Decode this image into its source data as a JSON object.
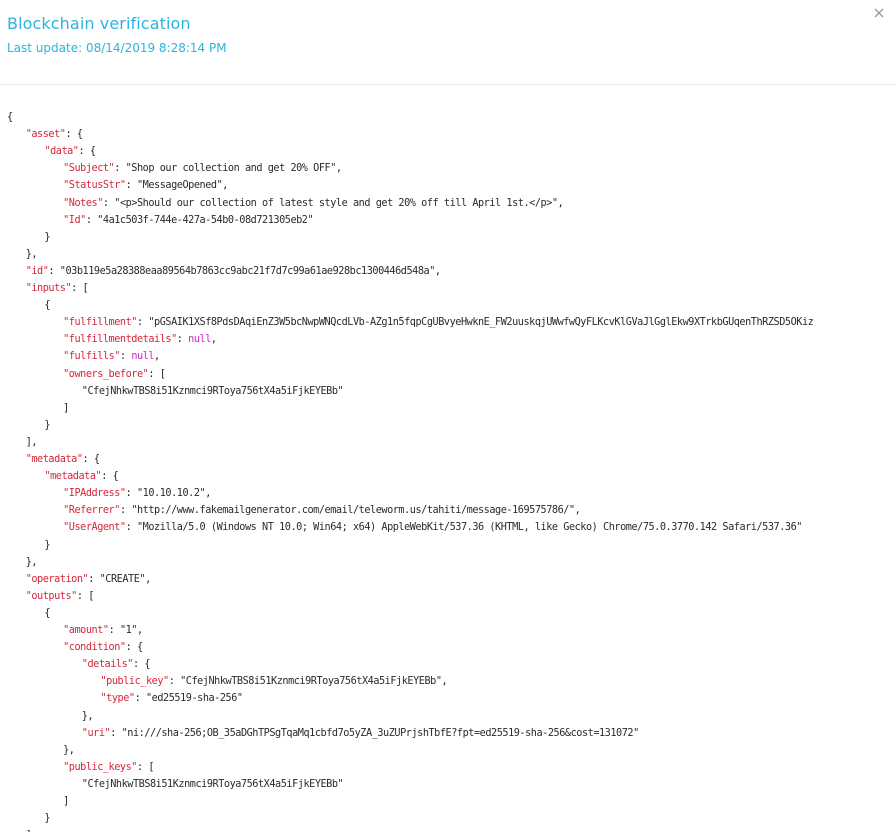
{
  "header": {
    "title": "Blockchain verification",
    "last_update": "Last update: 08/14/2019 8:28:14 PM",
    "close_icon": "close-icon"
  },
  "colors": {
    "title": "#2ab4e0",
    "json_key": "#d6263a",
    "json_null": "#d21fd2",
    "json_string": "#2a2a2a"
  },
  "json_lines": [
    {
      "indent": 0,
      "parts": [
        {
          "t": "p",
          "v": "{"
        }
      ]
    },
    {
      "indent": 1,
      "parts": [
        {
          "t": "k",
          "v": "\"asset\""
        },
        {
          "t": "p",
          "v": ": {"
        }
      ]
    },
    {
      "indent": 2,
      "parts": [
        {
          "t": "k",
          "v": "\"data\""
        },
        {
          "t": "p",
          "v": ": {"
        }
      ]
    },
    {
      "indent": 3,
      "parts": [
        {
          "t": "k",
          "v": "\"Subject\""
        },
        {
          "t": "p",
          "v": ": "
        },
        {
          "t": "s",
          "v": "\"Shop our collection and get 20% OFF\""
        },
        {
          "t": "p",
          "v": ","
        }
      ]
    },
    {
      "indent": 3,
      "parts": [
        {
          "t": "k",
          "v": "\"StatusStr\""
        },
        {
          "t": "p",
          "v": ": "
        },
        {
          "t": "s",
          "v": "\"MessageOpened\""
        },
        {
          "t": "p",
          "v": ","
        }
      ]
    },
    {
      "indent": 3,
      "parts": [
        {
          "t": "k",
          "v": "\"Notes\""
        },
        {
          "t": "p",
          "v": ": "
        },
        {
          "t": "s",
          "v": "\"<p>Should our collection of latest style and get 20% off till April 1st.</p>\""
        },
        {
          "t": "p",
          "v": ","
        }
      ]
    },
    {
      "indent": 3,
      "parts": [
        {
          "t": "k",
          "v": "\"Id\""
        },
        {
          "t": "p",
          "v": ": "
        },
        {
          "t": "s",
          "v": "\"4a1c503f-744e-427a-54b0-08d721305eb2\""
        }
      ]
    },
    {
      "indent": 2,
      "parts": [
        {
          "t": "p",
          "v": "}"
        }
      ]
    },
    {
      "indent": 1,
      "parts": [
        {
          "t": "p",
          "v": "},"
        }
      ]
    },
    {
      "indent": 1,
      "parts": [
        {
          "t": "k",
          "v": "\"id\""
        },
        {
          "t": "p",
          "v": ": "
        },
        {
          "t": "s",
          "v": "\"03b119e5a28388eaa89564b7863cc9abc21f7d7c99a61ae928bc1300446d548a\""
        },
        {
          "t": "p",
          "v": ","
        }
      ]
    },
    {
      "indent": 1,
      "parts": [
        {
          "t": "k",
          "v": "\"inputs\""
        },
        {
          "t": "p",
          "v": ": ["
        }
      ]
    },
    {
      "indent": 2,
      "parts": [
        {
          "t": "p",
          "v": "{"
        }
      ]
    },
    {
      "indent": 3,
      "parts": [
        {
          "t": "k",
          "v": "\"fulfillment\""
        },
        {
          "t": "p",
          "v": ": "
        },
        {
          "t": "s",
          "v": "\"pGSAIK1XSf8PdsDAqiEnZ3W5bcNwpWNQcdLVb-AZg1n5fqpCgUBvyeHwknE_FW2uuskqjUWwfwQyFLKcvKlGVaJlGglEkw9XTrkbGUqenThRZSD5OKiz"
        }
      ]
    },
    {
      "indent": 3,
      "parts": [
        {
          "t": "k",
          "v": "\"fulfillmentdetails\""
        },
        {
          "t": "p",
          "v": ": "
        },
        {
          "t": "n",
          "v": "null"
        },
        {
          "t": "p",
          "v": ","
        }
      ]
    },
    {
      "indent": 3,
      "parts": [
        {
          "t": "k",
          "v": "\"fulfills\""
        },
        {
          "t": "p",
          "v": ": "
        },
        {
          "t": "n",
          "v": "null"
        },
        {
          "t": "p",
          "v": ","
        }
      ]
    },
    {
      "indent": 3,
      "parts": [
        {
          "t": "k",
          "v": "\"owners_before\""
        },
        {
          "t": "p",
          "v": ": ["
        }
      ]
    },
    {
      "indent": 4,
      "parts": [
        {
          "t": "s",
          "v": "\"CfejNhkwTBS8i51Kznmci9RToya756tX4a5iFjkEYEBb\""
        }
      ]
    },
    {
      "indent": 3,
      "parts": [
        {
          "t": "p",
          "v": "]"
        }
      ]
    },
    {
      "indent": 2,
      "parts": [
        {
          "t": "p",
          "v": "}"
        }
      ]
    },
    {
      "indent": 1,
      "parts": [
        {
          "t": "p",
          "v": "],"
        }
      ]
    },
    {
      "indent": 1,
      "parts": [
        {
          "t": "k",
          "v": "\"metadata\""
        },
        {
          "t": "p",
          "v": ": {"
        }
      ]
    },
    {
      "indent": 2,
      "parts": [
        {
          "t": "k",
          "v": "\"metadata\""
        },
        {
          "t": "p",
          "v": ": {"
        }
      ]
    },
    {
      "indent": 3,
      "parts": [
        {
          "t": "k",
          "v": "\"IPAddress\""
        },
        {
          "t": "p",
          "v": ": "
        },
        {
          "t": "s",
          "v": "\"10.10.10.2\""
        },
        {
          "t": "p",
          "v": ","
        }
      ]
    },
    {
      "indent": 3,
      "parts": [
        {
          "t": "k",
          "v": "\"Referrer\""
        },
        {
          "t": "p",
          "v": ": "
        },
        {
          "t": "s",
          "v": "\"http://www.fakemailgenerator.com/email/teleworm.us/tahiti/message-169575786/\""
        },
        {
          "t": "p",
          "v": ","
        }
      ]
    },
    {
      "indent": 3,
      "parts": [
        {
          "t": "k",
          "v": "\"UserAgent\""
        },
        {
          "t": "p",
          "v": ": "
        },
        {
          "t": "s",
          "v": "\"Mozilla/5.0 (Windows NT 10.0; Win64; x64) AppleWebKit/537.36 (KHTML, like Gecko) Chrome/75.0.3770.142 Safari/537.36\""
        }
      ]
    },
    {
      "indent": 2,
      "parts": [
        {
          "t": "p",
          "v": "}"
        }
      ]
    },
    {
      "indent": 1,
      "parts": [
        {
          "t": "p",
          "v": "},"
        }
      ]
    },
    {
      "indent": 1,
      "parts": [
        {
          "t": "k",
          "v": "\"operation\""
        },
        {
          "t": "p",
          "v": ": "
        },
        {
          "t": "s",
          "v": "\"CREATE\""
        },
        {
          "t": "p",
          "v": ","
        }
      ]
    },
    {
      "indent": 1,
      "parts": [
        {
          "t": "k",
          "v": "\"outputs\""
        },
        {
          "t": "p",
          "v": ": ["
        }
      ]
    },
    {
      "indent": 2,
      "parts": [
        {
          "t": "p",
          "v": "{"
        }
      ]
    },
    {
      "indent": 3,
      "parts": [
        {
          "t": "k",
          "v": "\"amount\""
        },
        {
          "t": "p",
          "v": ": "
        },
        {
          "t": "s",
          "v": "\"1\""
        },
        {
          "t": "p",
          "v": ","
        }
      ]
    },
    {
      "indent": 3,
      "parts": [
        {
          "t": "k",
          "v": "\"condition\""
        },
        {
          "t": "p",
          "v": ": {"
        }
      ]
    },
    {
      "indent": 4,
      "parts": [
        {
          "t": "k",
          "v": "\"details\""
        },
        {
          "t": "p",
          "v": ": {"
        }
      ]
    },
    {
      "indent": 5,
      "parts": [
        {
          "t": "k",
          "v": "\"public_key\""
        },
        {
          "t": "p",
          "v": ": "
        },
        {
          "t": "s",
          "v": "\"CfejNhkwTBS8i51Kznmci9RToya756tX4a5iFjkEYEBb\""
        },
        {
          "t": "p",
          "v": ","
        }
      ]
    },
    {
      "indent": 5,
      "parts": [
        {
          "t": "k",
          "v": "\"type\""
        },
        {
          "t": "p",
          "v": ": "
        },
        {
          "t": "s",
          "v": "\"ed25519-sha-256\""
        }
      ]
    },
    {
      "indent": 4,
      "parts": [
        {
          "t": "p",
          "v": "},"
        }
      ]
    },
    {
      "indent": 4,
      "parts": [
        {
          "t": "k",
          "v": "\"uri\""
        },
        {
          "t": "p",
          "v": ": "
        },
        {
          "t": "s",
          "v": "\"ni:///sha-256;OB_35aDGhTPSgTqaMq1cbfd7o5yZA_3uZUPrjshTbfE?fpt=ed25519-sha-256&cost=131072\""
        }
      ]
    },
    {
      "indent": 3,
      "parts": [
        {
          "t": "p",
          "v": "},"
        }
      ]
    },
    {
      "indent": 3,
      "parts": [
        {
          "t": "k",
          "v": "\"public_keys\""
        },
        {
          "t": "p",
          "v": ": ["
        }
      ]
    },
    {
      "indent": 4,
      "parts": [
        {
          "t": "s",
          "v": "\"CfejNhkwTBS8i51Kznmci9RToya756tX4a5iFjkEYEBb\""
        }
      ]
    },
    {
      "indent": 3,
      "parts": [
        {
          "t": "p",
          "v": "]"
        }
      ]
    },
    {
      "indent": 2,
      "parts": [
        {
          "t": "p",
          "v": "}"
        }
      ]
    },
    {
      "indent": 1,
      "parts": [
        {
          "t": "p",
          "v": "],"
        }
      ]
    }
  ]
}
